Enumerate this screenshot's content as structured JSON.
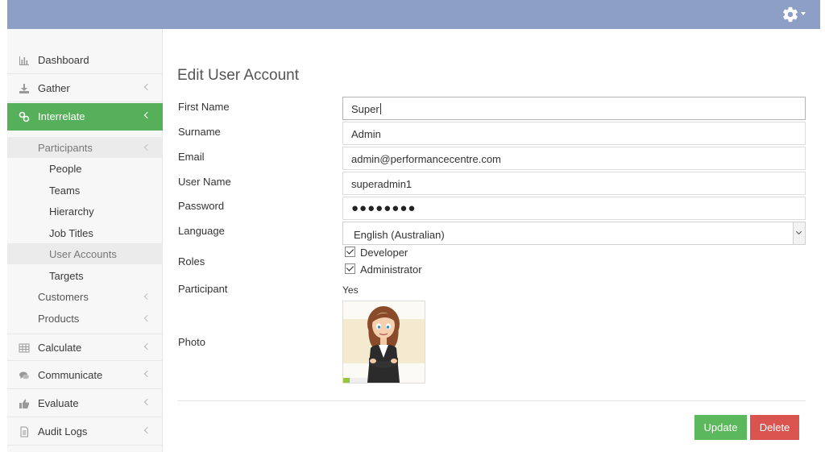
{
  "header": {
    "settings_icon": "gear-icon"
  },
  "sidebar": {
    "items": [
      {
        "label": "Dashboard",
        "icon": "bar-chart-icon"
      },
      {
        "label": "Gather",
        "icon": "download-icon"
      },
      {
        "label": "Interrelate",
        "icon": "link-icon",
        "active": true
      },
      {
        "label": "Calculate",
        "icon": "table-icon"
      },
      {
        "label": "Communicate",
        "icon": "comments-icon"
      },
      {
        "label": "Evaluate",
        "icon": "thumbs-up-icon"
      },
      {
        "label": "Audit Logs",
        "icon": "document-icon"
      }
    ],
    "interrelate_sub": {
      "participants": "Participants",
      "people": "People",
      "teams": "Teams",
      "hierarchy": "Hierarchy",
      "job_titles": "Job Titles",
      "user_accounts": "User Accounts",
      "targets": "Targets",
      "customers": "Customers",
      "products": "Products"
    }
  },
  "form": {
    "title": "Edit User Account",
    "labels": {
      "first_name": "First Name",
      "surname": "Surname",
      "email": "Email",
      "user_name": "User Name",
      "password": "Password",
      "language": "Language",
      "roles": "Roles",
      "participant": "Participant",
      "photo": "Photo"
    },
    "values": {
      "first_name": "Super",
      "surname": "Admin",
      "email": "admin@performancecentre.com",
      "user_name": "superadmin1",
      "password": "●●●●●●●●",
      "language": "English (Australian)",
      "participant": "Yes"
    },
    "roles": [
      {
        "label": "Developer",
        "checked": true
      },
      {
        "label": "Administrator",
        "checked": true
      }
    ],
    "buttons": {
      "update": "Update",
      "delete": "Delete"
    }
  },
  "colors": {
    "topbar": "#8e9fc6",
    "active_nav": "#56b05a",
    "update_button": "#5cb85c",
    "delete_button": "#d9534f"
  }
}
